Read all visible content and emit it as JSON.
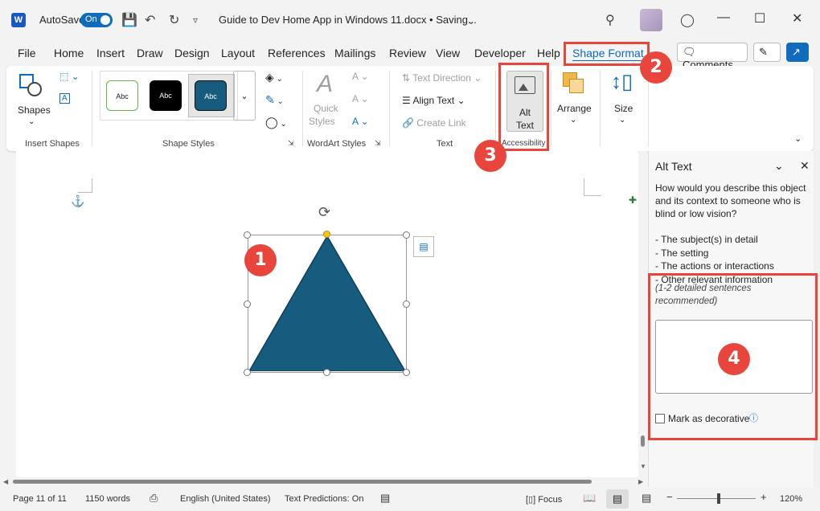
{
  "titlebar": {
    "app_icon": "W",
    "autosave_label": "AutoSave",
    "autosave_state": "On",
    "doc_title": "Guide to Dev Home App in Windows 11.docx • Saving...",
    "icons": [
      "save-icon",
      "undo-icon",
      "redo-icon",
      "customize-icon",
      "search-icon",
      "lightbulb-icon",
      "minimize-icon",
      "maximize-icon",
      "close-icon"
    ]
  },
  "menu": {
    "items": [
      "File",
      "Home",
      "Insert",
      "Draw",
      "Design",
      "Layout",
      "References",
      "Mailings",
      "Review",
      "View",
      "Developer",
      "Help"
    ],
    "active": "Shape Format",
    "comments": "Comments"
  },
  "ribbon": {
    "shapes": "Shapes",
    "insert_shapes": "Insert Shapes",
    "style_sample": "Abc",
    "shape_styles": "Shape Styles",
    "quick_styles_line1": "Quick",
    "quick_styles_line2": "Styles",
    "wordart_styles": "WordArt Styles",
    "text_direction": "Text Direction",
    "align_text": "Align Text",
    "create_link": "Create Link",
    "text_group": "Text",
    "alt_text_line1": "Alt",
    "alt_text_line2": "Text",
    "accessibility": "Accessibility",
    "arrange": "Arrange",
    "size": "Size"
  },
  "pane": {
    "title": "Alt Text",
    "question": "How would you describe this object and its context to someone who is blind or low vision?",
    "bullets": [
      "- The subject(s) in detail",
      "- The setting",
      "- The actions or interactions",
      "- Other relevant information"
    ],
    "hint": "(1-2 detailed sentences recommended)",
    "textarea_value": "",
    "decorative_label": "Mark as decorative"
  },
  "status": {
    "page": "Page 11 of 11",
    "words": "1150 words",
    "language": "English (United States)",
    "predictions": "Text Predictions: On",
    "focus": "Focus",
    "zoom": "120%",
    "zoom_minus": "−",
    "zoom_plus": "+"
  },
  "annotations": [
    "1",
    "2",
    "3",
    "4"
  ],
  "colors": {
    "accent": "#0f6cbd",
    "shape_fill": "#175c7e",
    "annotation": "#e8453c",
    "word_blue": "#185abd"
  }
}
